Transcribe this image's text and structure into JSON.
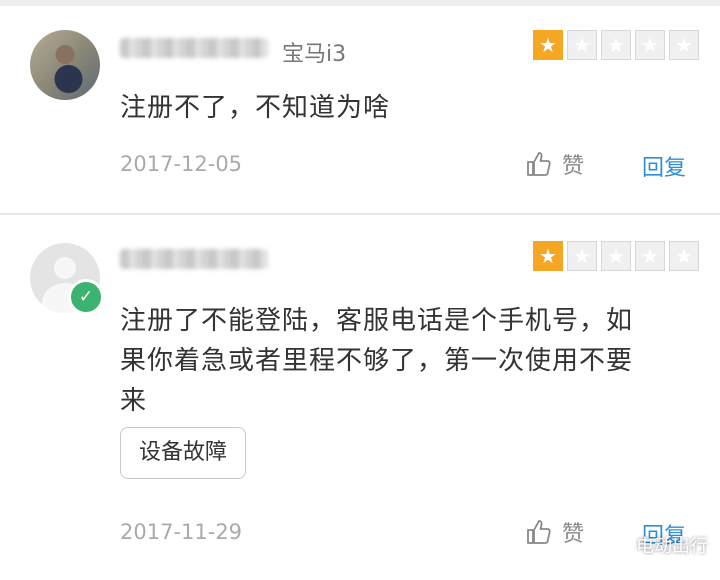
{
  "reviews": [
    {
      "car_model": "宝马i3",
      "rating": 1,
      "max_rating": 5,
      "text": "注册不了，不知道为啥",
      "date": "2017-12-05",
      "like_label": "赞",
      "reply_label": "回复"
    },
    {
      "car_model": "",
      "rating": 1,
      "max_rating": 5,
      "text_line1": "注册了不能登陆，客服电话是个手机号，如",
      "text_line2": "果你着急或者里程不够了，第一次使用不要",
      "text_line3": "来",
      "tag": "设备故障",
      "date": "2017-11-29",
      "like_label": "赞",
      "reply_label": "回复",
      "verified_mark": "✓"
    }
  ],
  "watermark": {
    "text": "电动出行",
    "icon": "wechat-icon"
  },
  "colors": {
    "star_filled": "#f5a623",
    "star_empty": "#f0f0f0",
    "reply": "#2e8fd6",
    "verified": "#3cb371"
  }
}
